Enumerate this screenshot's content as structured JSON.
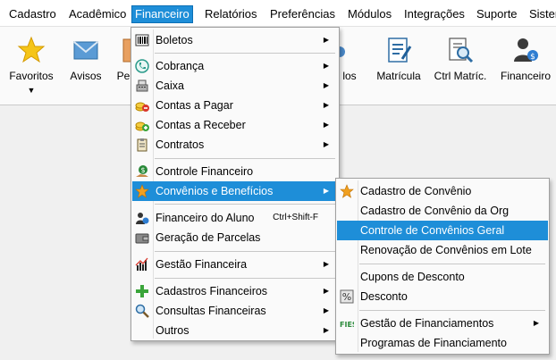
{
  "menubar": {
    "items": [
      {
        "label": "Cadastro"
      },
      {
        "label": "Acadêmico"
      },
      {
        "label": "Financeiro"
      },
      {
        "label": "Relatórios"
      },
      {
        "label": "Preferências"
      },
      {
        "label": "Módulos"
      },
      {
        "label": "Integrações"
      },
      {
        "label": "Suporte"
      },
      {
        "label": "Sistema"
      }
    ]
  },
  "toolbar": {
    "buttons": [
      {
        "label": "Favoritos",
        "icon": "star-icon"
      },
      {
        "label": "Avisos",
        "icon": "envelope-icon"
      },
      {
        "label": "Pe",
        "icon": "document-icon"
      },
      {
        "label": "los",
        "icon": "gear-icon"
      },
      {
        "label": "Matrícula",
        "icon": "form-icon"
      },
      {
        "label": "Ctrl Matríc.",
        "icon": "search-doc-icon"
      },
      {
        "label": "Financeiro",
        "icon": "user-money-icon"
      }
    ]
  },
  "financeiro_menu": {
    "items": [
      {
        "label": "Boletos",
        "icon": "barcode-icon",
        "submenu": true
      },
      {
        "label": "Cobrança",
        "icon": "phone-icon",
        "submenu": true
      },
      {
        "label": "Caixa",
        "icon": "register-icon",
        "submenu": true
      },
      {
        "label": "Contas a Pagar",
        "icon": "coins-minus-icon",
        "submenu": true
      },
      {
        "label": "Contas a Receber",
        "icon": "coins-plus-icon",
        "submenu": true
      },
      {
        "label": "Contratos",
        "icon": "clipboard-icon",
        "submenu": true
      },
      {
        "label": "Controle Financeiro",
        "icon": "money-hand-icon",
        "submenu": false
      },
      {
        "label": "Convênios e Benefícios",
        "icon": "star-icon",
        "submenu": true
      },
      {
        "label": "Financeiro do Aluno",
        "icon": "student-money-icon",
        "shortcut": "Ctrl+Shift-F",
        "submenu": false
      },
      {
        "label": "Geração de Parcelas",
        "icon": "wallet-icon",
        "submenu": false
      },
      {
        "label": "Gestão Financeira",
        "icon": "bar-chart-icon",
        "submenu": true
      },
      {
        "label": "Cadastros Financeiros",
        "icon": "plus-icon",
        "submenu": true
      },
      {
        "label": "Consultas Financeiras",
        "icon": "magnifier-icon",
        "submenu": true
      },
      {
        "label": "Outros",
        "icon": "",
        "submenu": true
      }
    ]
  },
  "convenios_submenu": {
    "items": [
      {
        "label": "Cadastro de Convênio",
        "icon": "star-icon"
      },
      {
        "label": "Cadastro de Convênio da Org",
        "icon": ""
      },
      {
        "label": "Controle de Convênios Geral",
        "icon": ""
      },
      {
        "label": "Renovação de Convênios em Lote",
        "icon": ""
      },
      {
        "label": "Cupons de Desconto",
        "icon": ""
      },
      {
        "label": "Desconto",
        "icon": "percent-icon"
      },
      {
        "label": "Gestão de Financiamentos",
        "icon": "fies-icon",
        "submenu": true
      },
      {
        "label": "Programas de Financiamento",
        "icon": ""
      }
    ]
  },
  "colors": {
    "highlight": "#1e8ed8",
    "menu_bg": "#fafafa"
  }
}
